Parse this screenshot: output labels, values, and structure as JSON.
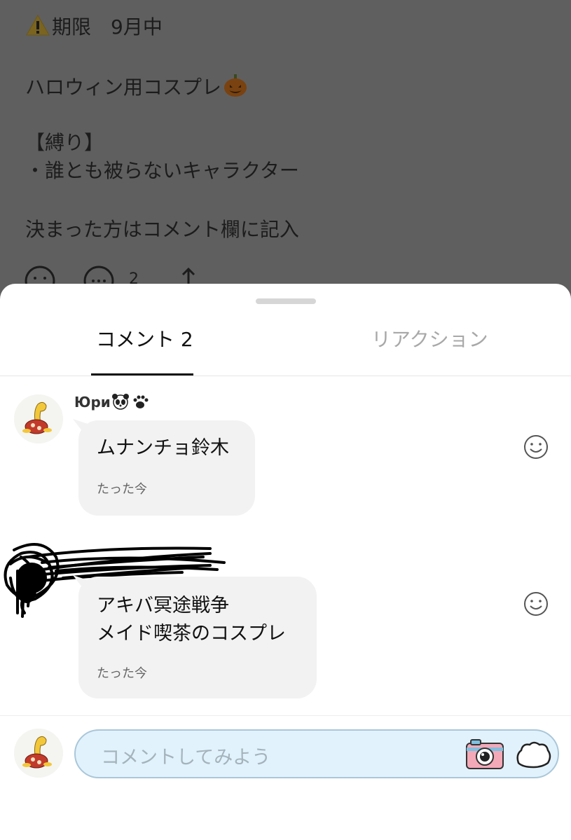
{
  "post": {
    "deadline": "期限　9月中",
    "title": "ハロウィン用コスプレ",
    "rule_heading": "【縛り】",
    "rule_item": "・誰とも被らないキャラクター",
    "instruction": "決まった方はコメント欄に記入",
    "comment_count": "2"
  },
  "tabs": {
    "comments": "コメント 2",
    "reactions": "リアクション"
  },
  "comments": [
    {
      "username": "Юри",
      "text": "ムナンチョ鈴木",
      "time": "たった今"
    },
    {
      "text": "アキバ冥途戦争\nメイド喫茶のコスプレ",
      "time": "たった今"
    }
  ],
  "composer": {
    "placeholder": "コメントしてみよう"
  },
  "colors": {
    "tab_active": "#111111",
    "tab_inactive": "#a8a8a8",
    "input_background": "#e2f2fc",
    "input_border": "#a9c7d9",
    "bubble": "#f2f2f2"
  },
  "icons": [
    "warning-icon",
    "pumpkin-icon",
    "smile-icon",
    "comment-icon",
    "share-icon",
    "panda-icon",
    "paw-icon",
    "react-smile-icon",
    "camera-icon",
    "stamp-icon"
  ]
}
